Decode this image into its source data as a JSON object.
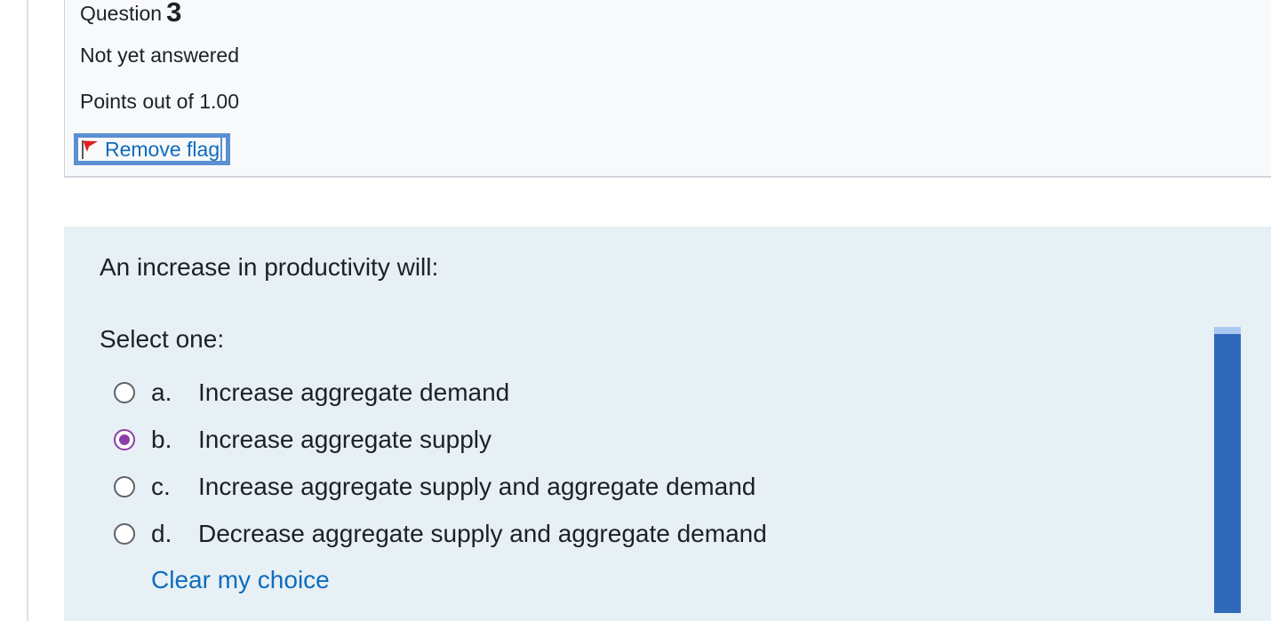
{
  "info": {
    "question_label": "Question",
    "question_number": "3",
    "state": "Not yet answered",
    "grade": "Points out of 1.00",
    "flag_label": "Remove flag"
  },
  "formulation": {
    "question_text": "An increase in productivity will:",
    "prompt": "Select one:",
    "options": [
      {
        "letter": "a.",
        "text": "Increase aggregate demand",
        "selected": false
      },
      {
        "letter": "b.",
        "text": "Increase aggregate supply",
        "selected": true
      },
      {
        "letter": "c.",
        "text": "Increase aggregate supply and aggregate demand",
        "selected": false
      },
      {
        "letter": "d.",
        "text": "Decrease aggregate supply and aggregate demand",
        "selected": false
      }
    ],
    "clear_label": "Clear my choice"
  },
  "icons": {
    "flag": "flag-icon"
  },
  "colors": {
    "link": "#0f6cbf",
    "radio_selected": "#8d3fa8",
    "focus_outline": "#5b8fd0",
    "formulation_bg": "#e7f0f4",
    "info_bg": "#f8f9fa",
    "flag_red": "#e02020"
  }
}
